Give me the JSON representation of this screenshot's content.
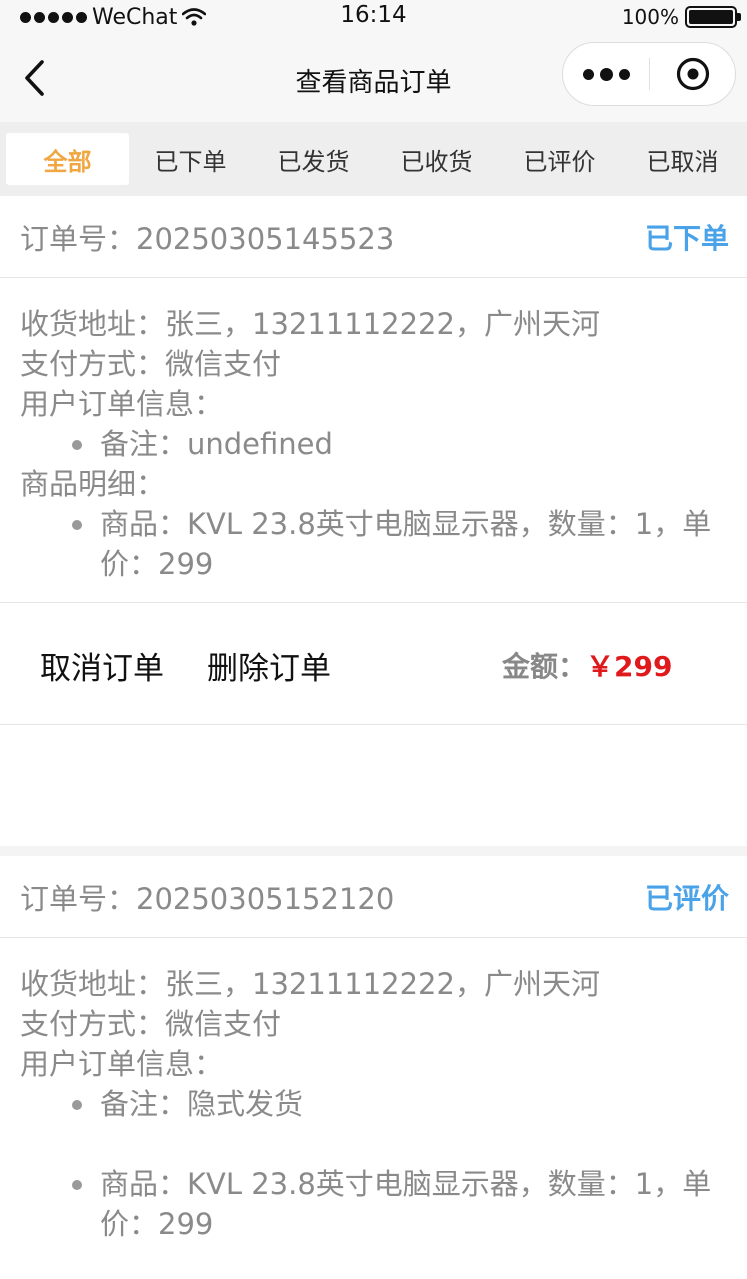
{
  "status_bar": {
    "carrier": "WeChat",
    "time": "16:14",
    "battery": "100%"
  },
  "nav": {
    "title": "查看商品订单"
  },
  "tabs": [
    {
      "label": "全部",
      "active": true
    },
    {
      "label": "已下单",
      "active": false
    },
    {
      "label": "已发货",
      "active": false
    },
    {
      "label": "已收货",
      "active": false
    },
    {
      "label": "已评价",
      "active": false
    },
    {
      "label": "已取消",
      "active": false
    }
  ],
  "orders": [
    {
      "order_no": "订单号：20250305145523",
      "status": "已下单",
      "address": "收货地址：张三，13211112222，广州天河",
      "payment": "支付方式：微信支付",
      "info_label": "用户订单信息：",
      "note": "备注：undefined",
      "detail_label": "商品明细：",
      "item": "商品：KVL 23.8英寸电脑显示器，数量：1，单价：299",
      "cancel_label": "取消订单",
      "delete_label": "删除订单",
      "amount_label": "金额：",
      "amount_value": "￥299"
    },
    {
      "order_no": "订单号：20250305152120",
      "status": "已评价",
      "address": "收货地址：张三，13211112222，广州天河",
      "payment": "支付方式：微信支付",
      "info_label": "用户订单信息：",
      "note": "备注：隐式发货",
      "item": "商品：KVL 23.8英寸电脑显示器，数量：1，单价：299"
    }
  ],
  "colors": {
    "tab_active": "#f0a741",
    "status": "#4aa3e8",
    "price": "#e0191c"
  }
}
